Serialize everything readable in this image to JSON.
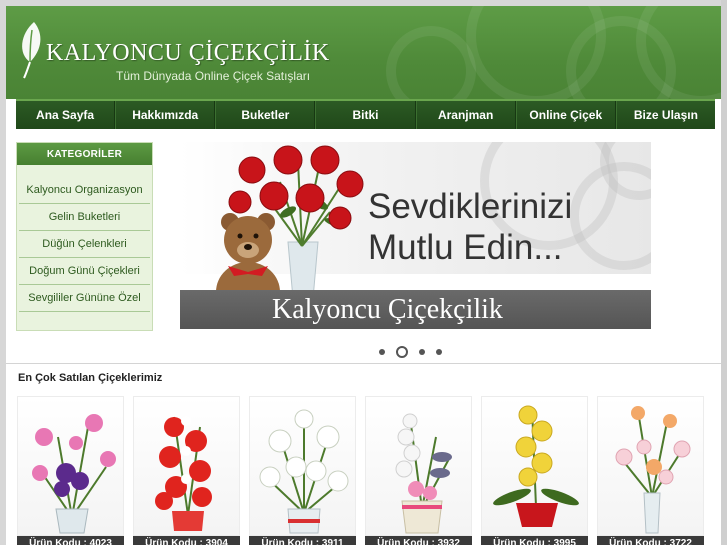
{
  "header": {
    "logo_title": "KALYONCU ÇİÇEKÇİLİK",
    "tagline": "Tüm Dünyada Online Çiçek Satışları"
  },
  "nav": {
    "items": [
      {
        "label": "Ana Sayfa"
      },
      {
        "label": "Hakkımızda"
      },
      {
        "label": "Buketler"
      },
      {
        "label": "Bitki"
      },
      {
        "label": "Aranjman"
      },
      {
        "label": "Online Çiçek"
      },
      {
        "label": "Bize Ulaşın"
      }
    ]
  },
  "sidebar": {
    "title": "KATEGORİLER",
    "items": [
      {
        "label": "Kalyoncu Organizasyon"
      },
      {
        "label": "Gelin Buketleri"
      },
      {
        "label": "Düğün Çelenkleri"
      },
      {
        "label": "Doğum Günü Çiçekleri"
      },
      {
        "label": "Sevgililer Gününe Özel"
      }
    ]
  },
  "banner": {
    "headline_line1": "Sevdiklerinizi",
    "headline_line2": "Mutlu Edin...",
    "brand": "Kalyoncu Çiçekçilik",
    "active_slide": 2,
    "slide_count": 4
  },
  "products": {
    "title": "En Çok Satılan Çiçeklerimiz",
    "items": [
      {
        "code": "Ürün Kodu : 4023"
      },
      {
        "code": "Ürün Kodu : 3904"
      },
      {
        "code": "Ürün Kodu : 3911"
      },
      {
        "code": "Ürün Kodu : 3932"
      },
      {
        "code": "Ürün Kodu : 3995"
      },
      {
        "code": "Ürün Kodu : 3722"
      }
    ]
  },
  "colors": {
    "header_green": "#5e9c46",
    "nav_dark_green": "#2c5a24",
    "sidebar_bg": "#e9f3de",
    "sidebar_text": "#2d5a1e"
  }
}
